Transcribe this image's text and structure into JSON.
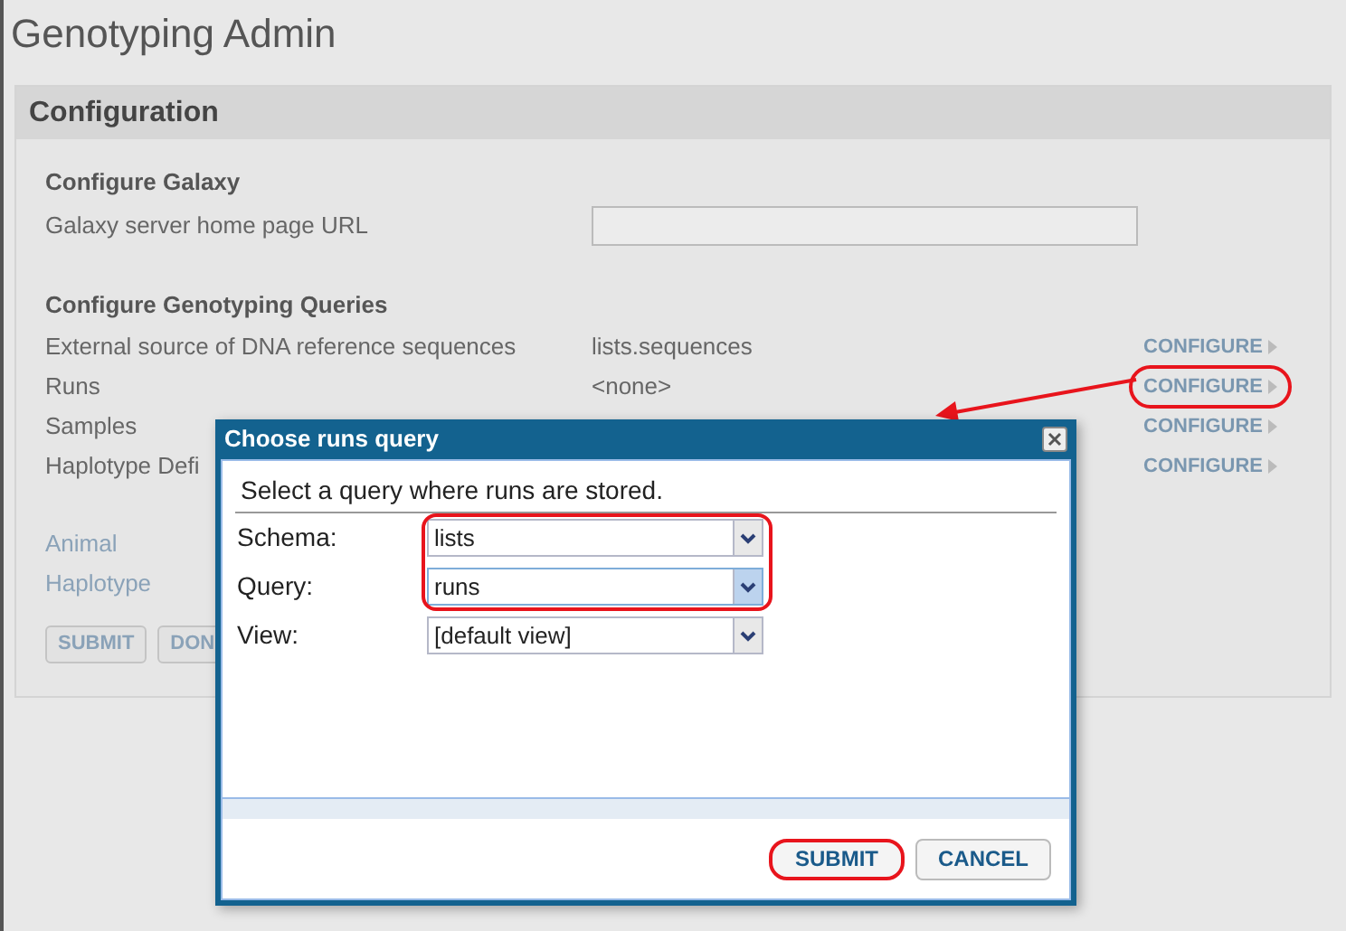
{
  "page_title": "Genotyping Admin",
  "panel": {
    "title": "Configuration",
    "galaxy": {
      "heading": "Configure Galaxy",
      "label": "Galaxy server home page URL"
    },
    "queries": {
      "heading": "Configure Genotyping Queries",
      "rows": [
        {
          "label": "External source of DNA reference sequences",
          "value": "lists.sequences",
          "action": "CONFIGURE",
          "highlighted": false
        },
        {
          "label": "Runs",
          "value": "<none>",
          "action": "CONFIGURE",
          "highlighted": true
        },
        {
          "label": "Samples",
          "action": "CONFIGURE",
          "highlighted": false
        },
        {
          "label": "Haplotype Defi",
          "action": "CONFIGURE",
          "highlighted": false
        }
      ]
    },
    "links": [
      "Animal",
      "Haplotype"
    ],
    "buttons": [
      "SUBMIT",
      "DON"
    ]
  },
  "dialog": {
    "title": "Choose runs query",
    "message": "Select a query where runs are stored.",
    "fields": [
      {
        "label": "Schema:",
        "value": "lists",
        "highlighted": true,
        "focused": false
      },
      {
        "label": "Query:",
        "value": "runs",
        "highlighted": true,
        "focused": true
      },
      {
        "label": "View:",
        "value": "[default view]",
        "highlighted": false,
        "focused": false
      }
    ],
    "buttons": [
      {
        "label": "SUBMIT",
        "highlighted": true
      },
      {
        "label": "CANCEL",
        "highlighted": false
      }
    ]
  }
}
